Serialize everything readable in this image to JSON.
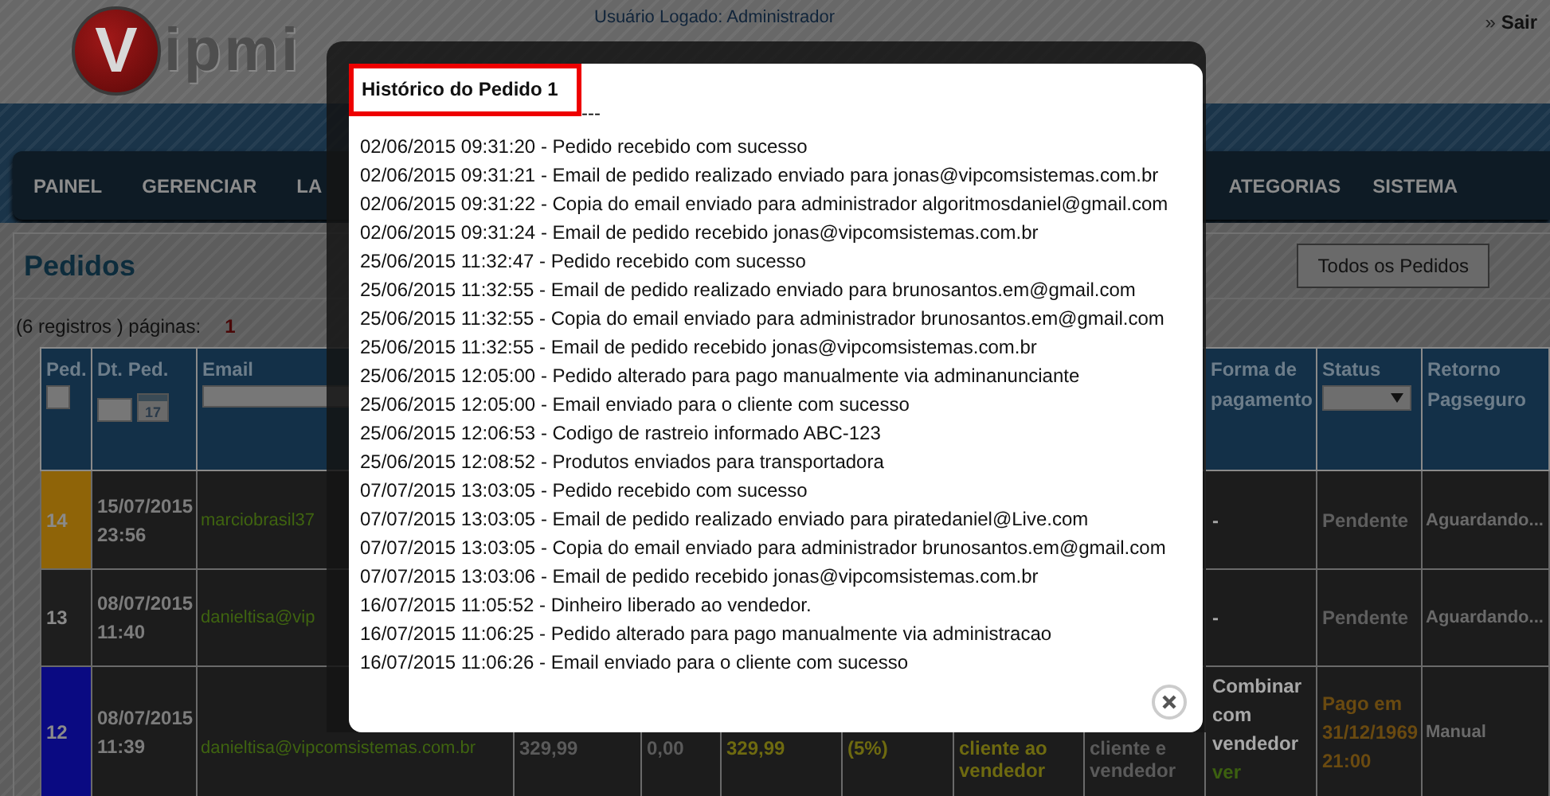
{
  "header": {
    "logo": {
      "mark": "V",
      "text": "ipmi"
    },
    "user": "Usuário Logado: Administrador",
    "logout": {
      "icon": "»",
      "label": "Sair"
    }
  },
  "nav": {
    "left": [
      {
        "label": "PAINEL"
      },
      {
        "label": "GERENCIAR"
      },
      {
        "label": "LA"
      }
    ],
    "right": [
      {
        "label": "ATEGORIAS"
      },
      {
        "label": "SISTEMA"
      }
    ]
  },
  "page": {
    "title": "Pedidos",
    "all_button": "Todos os Pedidos",
    "pagination": {
      "label": "(6 registros ) páginas:",
      "pages": [
        {
          "label": "1",
          "selected": true
        }
      ]
    }
  },
  "table": {
    "columns_left": [
      {
        "label": "Ped.",
        "kind": "checkbox",
        "checked": false
      },
      {
        "label": "Dt. Ped.",
        "kind": "date",
        "calendar": "17"
      },
      {
        "label": "Email",
        "kind": "text"
      }
    ],
    "columns_right": [
      {
        "label": "Forma de pagamento"
      },
      {
        "label": "Status",
        "kind": "select"
      },
      {
        "label": "Retorno Pagseguro"
      }
    ],
    "rows": [
      {
        "ped": "14",
        "color": "#8f6408",
        "date": "15/07/2015 23:56",
        "email": "marciobrasil37",
        "payment": {
          "text": "-"
        },
        "status": {
          "kind": "pending",
          "text": "Pendente"
        },
        "return": "Aguardando..."
      },
      {
        "ped": "13",
        "color": "#1e1e1e",
        "date": "08/07/2015 11:40",
        "email": "danieltisa@vip",
        "payment": {
          "text": "-"
        },
        "status": {
          "kind": "pending",
          "text": "Pendente"
        },
        "return": "Aguardando..."
      },
      {
        "ped": "12",
        "color": "#0a0a82",
        "date": "08/07/2015 11:39",
        "email": "danieltisa@vipcomsistemas.com.br",
        "hidden_cells": [
          {
            "lines": [
              "329,99"
            ],
            "color": "#5a5a5a"
          },
          {
            "lines": [
              "0,00"
            ],
            "color": "#5a5a5a"
          },
          {
            "lines": [
              "329,99"
            ],
            "color": "#6e6a10"
          },
          {
            "lines": [
              "(5%)"
            ],
            "color": "#6e6a10"
          },
          {
            "lines": [
              "cliente ao",
              "vendedor"
            ],
            "color": "#6e6a10"
          },
          {
            "lines": [
              "cliente e",
              "vendedor"
            ],
            "color": "#5a5a5a"
          }
        ],
        "payment": {
          "text": "Combinar com vendedor",
          "link": "ver"
        },
        "status": {
          "kind": "paid",
          "text": "Pago em 31/12/1969 21:00"
        },
        "return": "Manual"
      }
    ]
  },
  "modal": {
    "title": "Histórico do Pedido 1",
    "separator": "---",
    "entries": [
      "02/06/2015 09:31:20 - Pedido recebido com sucesso",
      "02/06/2015 09:31:21 - Email de pedido realizado enviado para jonas@vipcomsistemas.com.br",
      "02/06/2015 09:31:22 - Copia do email enviado para administrador algoritmosdaniel@gmail.com",
      "02/06/2015 09:31:24 - Email de pedido recebido jonas@vipcomsistemas.com.br",
      "25/06/2015 11:32:47 - Pedido recebido com sucesso",
      "25/06/2015 11:32:55 - Email de pedido realizado enviado para brunosantos.em@gmail.com",
      "25/06/2015 11:32:55 - Copia do email enviado para administrador brunosantos.em@gmail.com",
      "25/06/2015 11:32:55 - Email de pedido recebido jonas@vipcomsistemas.com.br",
      "25/06/2015 12:05:00 - Pedido alterado para pago manualmente via adminanunciante",
      "25/06/2015 12:05:00 - Email enviado para o cliente com sucesso",
      "25/06/2015 12:06:53 - Codigo de rastreio informado ABC-123",
      "25/06/2015 12:08:52 - Produtos enviados para transportadora",
      "07/07/2015 13:03:05 - Pedido recebido com sucesso",
      "07/07/2015 13:03:05 - Email de pedido realizado enviado para piratedaniel@Live.com",
      "07/07/2015 13:03:05 - Copia do email enviado para administrador brunosantos.em@gmail.com",
      "07/07/2015 13:03:06 - Email de pedido recebido jonas@vipcomsistemas.com.br",
      "16/07/2015 11:05:52 - Dinheiro liberado ao vendedor.",
      "16/07/2015 11:06:25 - Pedido alterado para pago manualmente via administracao",
      "16/07/2015 11:06:26 - Email enviado para o cliente com sucesso"
    ]
  }
}
